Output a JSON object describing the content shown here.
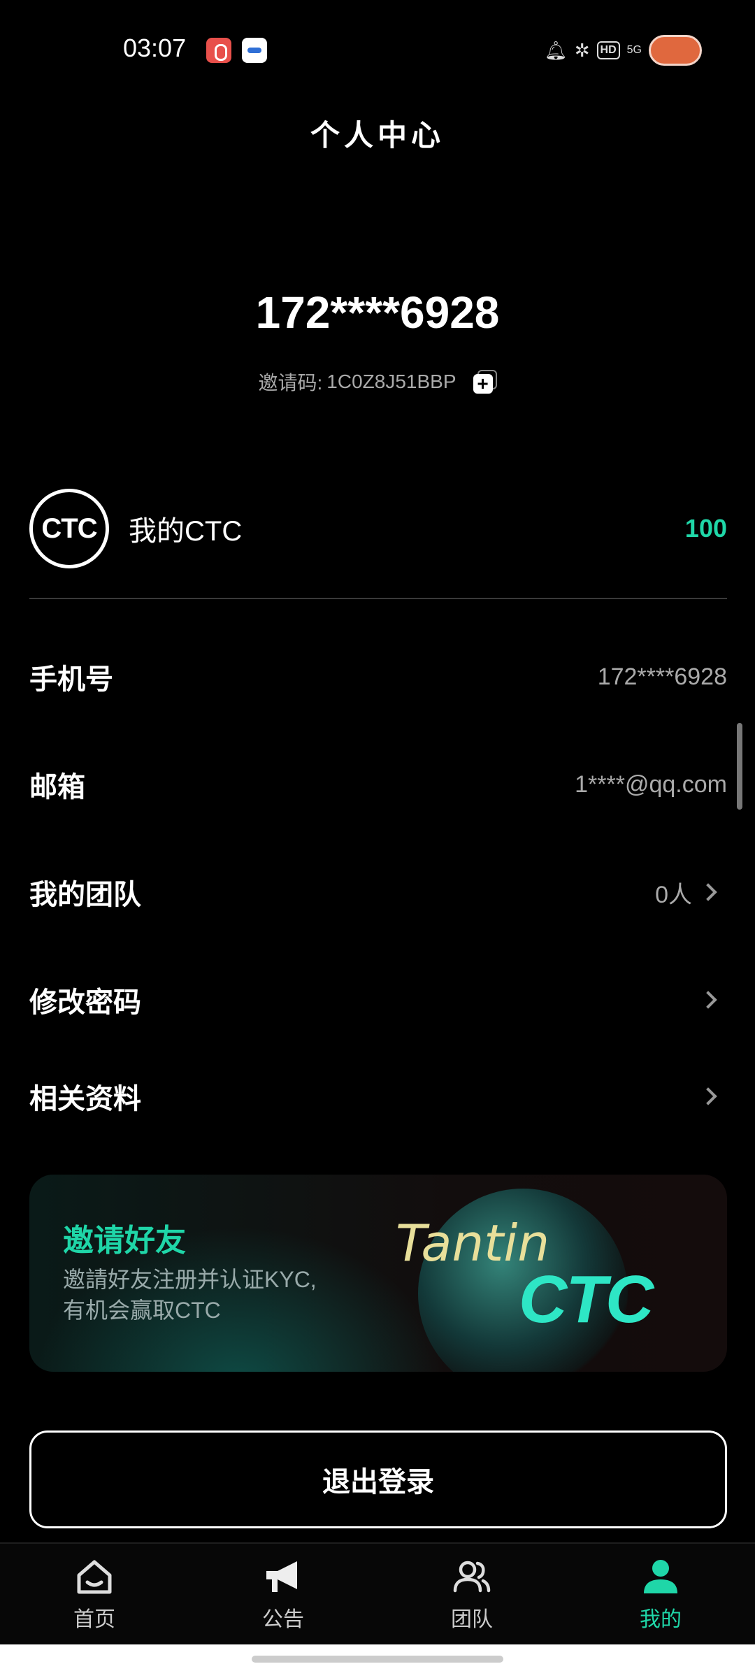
{
  "status_bar": {
    "time": "03:07",
    "icons": [
      "bell-icon",
      "bluetooth-icon",
      "hd-voice-icon",
      "5g-signal-icon",
      "battery-icon"
    ],
    "hd_label": "HD",
    "network_label": "5G"
  },
  "header": {
    "title": "个人中心"
  },
  "profile": {
    "phone_masked": "172****6928",
    "invite_label": "邀请码:",
    "invite_code": "1C0Z8J51BBP"
  },
  "ctc": {
    "logo_text": "CTC",
    "label": "我的CTC",
    "value": "100"
  },
  "rows": [
    {
      "label": "手机号",
      "value": "172****6928"
    },
    {
      "label": "邮箱",
      "value": "1****@qq.com"
    },
    {
      "label": "我的团队",
      "value": "0人"
    },
    {
      "label": "修改密码",
      "value": ""
    },
    {
      "label": "相关资料",
      "value": ""
    }
  ],
  "banner": {
    "title": "邀请好友",
    "line1": "邀請好友注册并认证KYC,",
    "line2": "有机会赢取CTC",
    "brand_script": "Tantin",
    "brand_ctc": "CTC"
  },
  "logout_label": "退出登录",
  "nav": [
    {
      "label": "首页",
      "icon": "home-icon"
    },
    {
      "label": "公告",
      "icon": "megaphone-icon"
    },
    {
      "label": "团队",
      "icon": "team-icon"
    },
    {
      "label": "我的",
      "icon": "user-icon",
      "active": true
    }
  ],
  "colors": {
    "accent": "#1fd6a8",
    "background": "#000000"
  }
}
